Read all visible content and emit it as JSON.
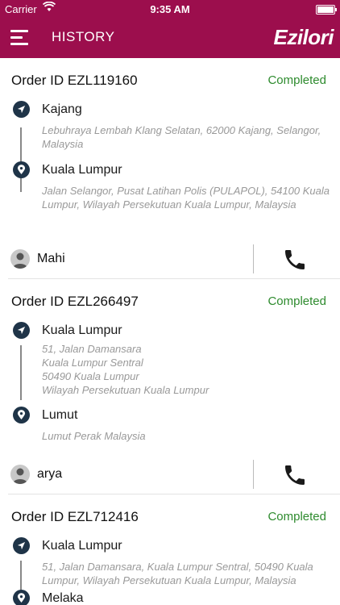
{
  "status_bar": {
    "carrier": "Carrier",
    "time": "9:35 AM",
    "battery_level": 1.0
  },
  "app_bar": {
    "title": "HISTORY",
    "brand": "Ezilori"
  },
  "icons": {
    "menu": "hamburger-icon",
    "pickup": "navigation-arrow-icon",
    "dropoff": "map-pin-icon",
    "avatar": "user-avatar-icon",
    "call": "phone-icon"
  },
  "colors": {
    "brand": "#9c0e4d",
    "status_completed": "#2e8b2e",
    "stop_icon": "#1f3448"
  },
  "orders": [
    {
      "order_id": "Order ID EZL119160",
      "status": "Completed",
      "pickup": {
        "name": "Kajang",
        "address": "Lebuhraya Lembah Klang Selatan, 62000 Kajang, Selangor, Malaysia"
      },
      "dropoff": {
        "name": "Kuala Lumpur",
        "address": "Jalan Selangor, Pusat Latihan Polis (PULAPOL), 54100 Kuala Lumpur, Wilayah Persekutuan Kuala Lumpur, Malaysia"
      },
      "driver": "Mahi"
    },
    {
      "order_id": "Order ID EZL266497",
      "status": "Completed",
      "pickup": {
        "name": "Kuala Lumpur",
        "address": "51, Jalan Damansara\nKuala Lumpur Sentral\n50490 Kuala Lumpur\nWilayah Persekutuan Kuala Lumpur"
      },
      "dropoff": {
        "name": "Lumut",
        "address": "Lumut Perak Malaysia"
      },
      "driver": "arya"
    },
    {
      "order_id": "Order ID EZL712416",
      "status": "Completed",
      "pickup": {
        "name": "Kuala Lumpur",
        "address": "51, Jalan Damansara, Kuala Lumpur Sentral, 50490 Kuala Lumpur, Wilayah Persekutuan Kuala Lumpur, Malaysia"
      },
      "dropoff": {
        "name": "Melaka",
        "address": ""
      },
      "driver": ""
    }
  ]
}
